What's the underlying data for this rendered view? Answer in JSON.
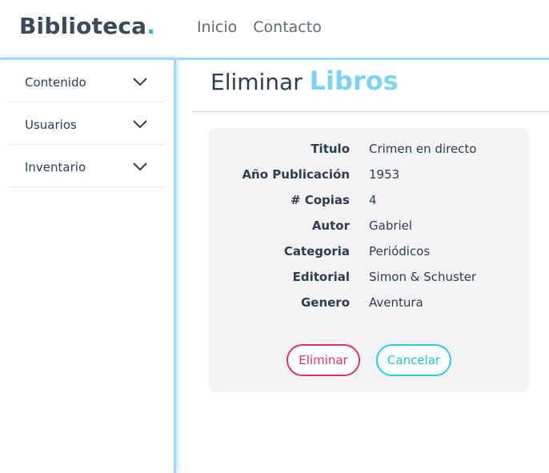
{
  "brand": {
    "name": "Biblioteca",
    "dot": "."
  },
  "nav": {
    "items": [
      "Inicio",
      "Contacto"
    ]
  },
  "sidebar": {
    "items": [
      {
        "label": "Contenido",
        "icon": "chevron-down-icon"
      },
      {
        "label": "Usuarios",
        "icon": "chevron-down-icon"
      },
      {
        "label": "Inventario",
        "icon": "chevron-down-icon"
      }
    ]
  },
  "page": {
    "title_prefix": "Eliminar",
    "title_accent": "Libros"
  },
  "details": [
    {
      "key": "Titulo",
      "value": "Crimen en directo"
    },
    {
      "key": "Año Publicación",
      "value": "1953"
    },
    {
      "key": "# Copias",
      "value": "4"
    },
    {
      "key": "Autor",
      "value": "Gabriel"
    },
    {
      "key": "Categoria",
      "value": "Periódicos"
    },
    {
      "key": "Editorial",
      "value": "Simon & Schuster"
    },
    {
      "key": "Genero",
      "value": "Aventura"
    }
  ],
  "actions": {
    "delete_label": "Eliminar",
    "cancel_label": "Cancelar"
  },
  "colors": {
    "accent": "#7ed3f4",
    "brand_dot": "#29b6e8",
    "delete": "#e0306c",
    "cancel": "#22d1d6",
    "card_bg": "#f3f3f5"
  }
}
